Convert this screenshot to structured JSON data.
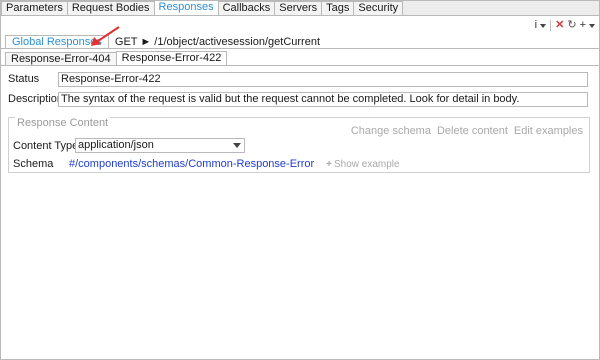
{
  "tabs": [
    {
      "label": "Parameters"
    },
    {
      "label": "Request Bodies"
    },
    {
      "label": "Responses",
      "active": true
    },
    {
      "label": "Callbacks"
    },
    {
      "label": "Servers"
    },
    {
      "label": "Tags"
    },
    {
      "label": "Security"
    }
  ],
  "toolbar": {
    "info": "i",
    "delete": "✕",
    "refresh": "↻",
    "add": "+"
  },
  "breadcrumb": {
    "global": "Global Responses",
    "path": "GET ► /1/object/activesession/getCurrent"
  },
  "response_tabs": [
    {
      "label": "Response-Error-404"
    },
    {
      "label": "Response-Error-422",
      "active": true
    }
  ],
  "form": {
    "status_label": "Status",
    "status_value": "Response-Error-422",
    "description_label": "Description",
    "description_value": "The syntax of the request is valid but the request cannot be completed. Look for detail in body."
  },
  "content": {
    "title": "Response Content",
    "change_schema": "Change schema",
    "delete_content": "Delete content",
    "edit_examples": "Edit examples",
    "content_type_label": "Content Type",
    "content_type_value": "application/json",
    "schema_label": "Schema",
    "schema_link": "#/components/schemas/Common-Response-Error",
    "show_example": "Show example",
    "show_example_plus": "+"
  },
  "colors": {
    "accent": "#2a8fd6",
    "link": "#1f3dcc",
    "delete": "#d43a3a",
    "annotation_arrow": "#e0322f"
  }
}
